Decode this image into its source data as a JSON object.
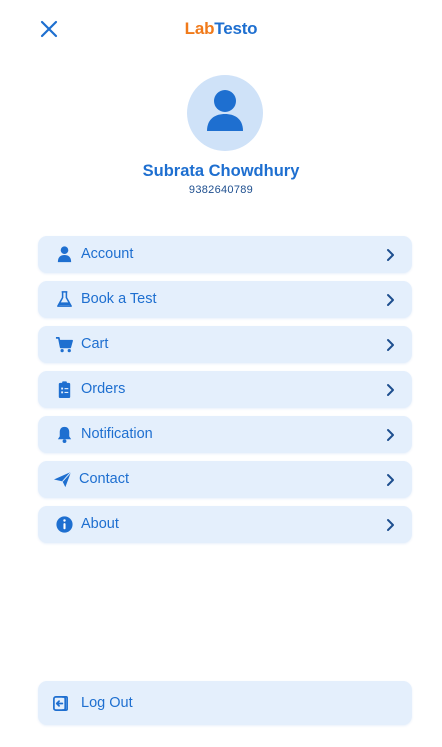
{
  "header": {
    "logo_part1": "Lab",
    "logo_part2": "Testo",
    "close_icon": "close-icon"
  },
  "profile": {
    "name": "Subrata Chowdhury",
    "phone": "9382640789",
    "avatar_icon": "user-avatar-icon"
  },
  "menu": {
    "items": [
      {
        "label": "Account",
        "icon": "user-icon"
      },
      {
        "label": "Book a Test",
        "icon": "flask-icon"
      },
      {
        "label": "Cart",
        "icon": "cart-icon"
      },
      {
        "label": "Orders",
        "icon": "clipboard-list-icon"
      },
      {
        "label": "Notification",
        "icon": "bell-icon"
      },
      {
        "label": "Contact",
        "icon": "paper-plane-icon"
      },
      {
        "label": "About",
        "icon": "info-icon"
      }
    ]
  },
  "logout": {
    "label": "Log Out",
    "icon": "logout-icon"
  },
  "colors": {
    "primary": "#1e6fd0",
    "logo_accent": "#f07a1a",
    "item_bg": "#e4effc",
    "avatar_bg": "#cfe2f8"
  }
}
